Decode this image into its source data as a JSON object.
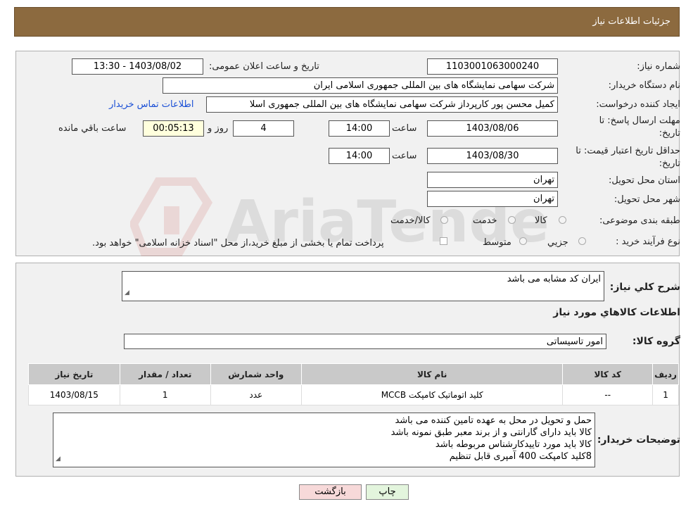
{
  "header": {
    "title": "جزئیات اطلاعات نیاز"
  },
  "form": {
    "need_number_label": "شماره نیاز:",
    "need_number": "1103001063000240",
    "announce_label": "تاریخ و ساعت اعلان عمومی:",
    "announce_value": "1403/08/02 - 13:30",
    "buyer_org_label": "نام دستگاه خریدار:",
    "buyer_org": "شرکت سهامی نمایشگاه های بین المللی جمهوری اسلامی ایران",
    "creator_label": "ایجاد کننده درخواست:",
    "creator": "کمیل محسن پور کارپرداز شرکت سهامی نمایشگاه های بین المللی جمهوری اسلا",
    "contact_link": "اطلاعات تماس خریدار",
    "deadline_label_1": "مهلت ارسال پاسخ: تا",
    "deadline_label_2": "تاریخ:",
    "deadline_date": "1403/08/06",
    "time_label": "ساعت",
    "deadline_time": "14:00",
    "days_value": "4",
    "days_label": "روز و",
    "remaining_time": "00:05:13",
    "remaining_label": "ساعت باقي مانده",
    "validity_label_1": "حداقل تاریخ اعتبار قیمت: تا",
    "validity_label_2": "تاریخ:",
    "validity_date": "1403/08/30",
    "validity_time_label": "ساعت",
    "validity_time": "14:00",
    "province_label": "استان محل تحویل:",
    "province": "تهران",
    "city_label": "شهر محل تحویل:",
    "city": "تهران",
    "category_label": "طبقه بندی موضوعی:",
    "category_options": [
      "کالا",
      "خدمت",
      "کالا/خدمت"
    ],
    "process_label": "نوع فرآیند خرید :",
    "process_options": [
      "جزیي",
      "متوسط"
    ],
    "payment_note": "پرداخت تمام یا بخشی از مبلغ خرید،از محل \"اسناد خزانه اسلامی\" خواهد بود."
  },
  "details": {
    "summary_label": "شرح کلي نیاز:",
    "summary": "ایران کد مشابه می باشد",
    "goods_info_title": "اطلاعات کالاهاي مورد نیاز",
    "group_label": "گروه کالا:",
    "group": "امور تاسیساتی",
    "table": {
      "headers": [
        "ردیف",
        "کد کالا",
        "نام کالا",
        "واحد شمارش",
        "تعداد / مقدار",
        "تاریخ نیاز"
      ],
      "rows": [
        [
          "1",
          "--",
          "کلید اتوماتیک کامپکت MCCB",
          "عدد",
          "1",
          "1403/08/15"
        ]
      ]
    },
    "buyer_notes_label": "توضیحات خریدار:",
    "buyer_notes": [
      "حمل و تحویل در محل به عهده تامین کننده می باشد",
      "کالا باید دارای گارانتی و از برند معبر طبق نمونه باشد",
      "کالا باید مورد تاییدکارشناس مربوطه باشد",
      "8کلید کامپکت 400 آمپری قابل تنظیم"
    ]
  },
  "buttons": {
    "back": "بازگشت",
    "print": "چاپ"
  },
  "watermark": {
    "text": "AriaTender.neT"
  },
  "colors": {
    "header_bg": "#8c6a3f",
    "link": "#1a4fd6",
    "back_btn": "#f7d9d9",
    "print_btn": "#e3f5dd"
  }
}
